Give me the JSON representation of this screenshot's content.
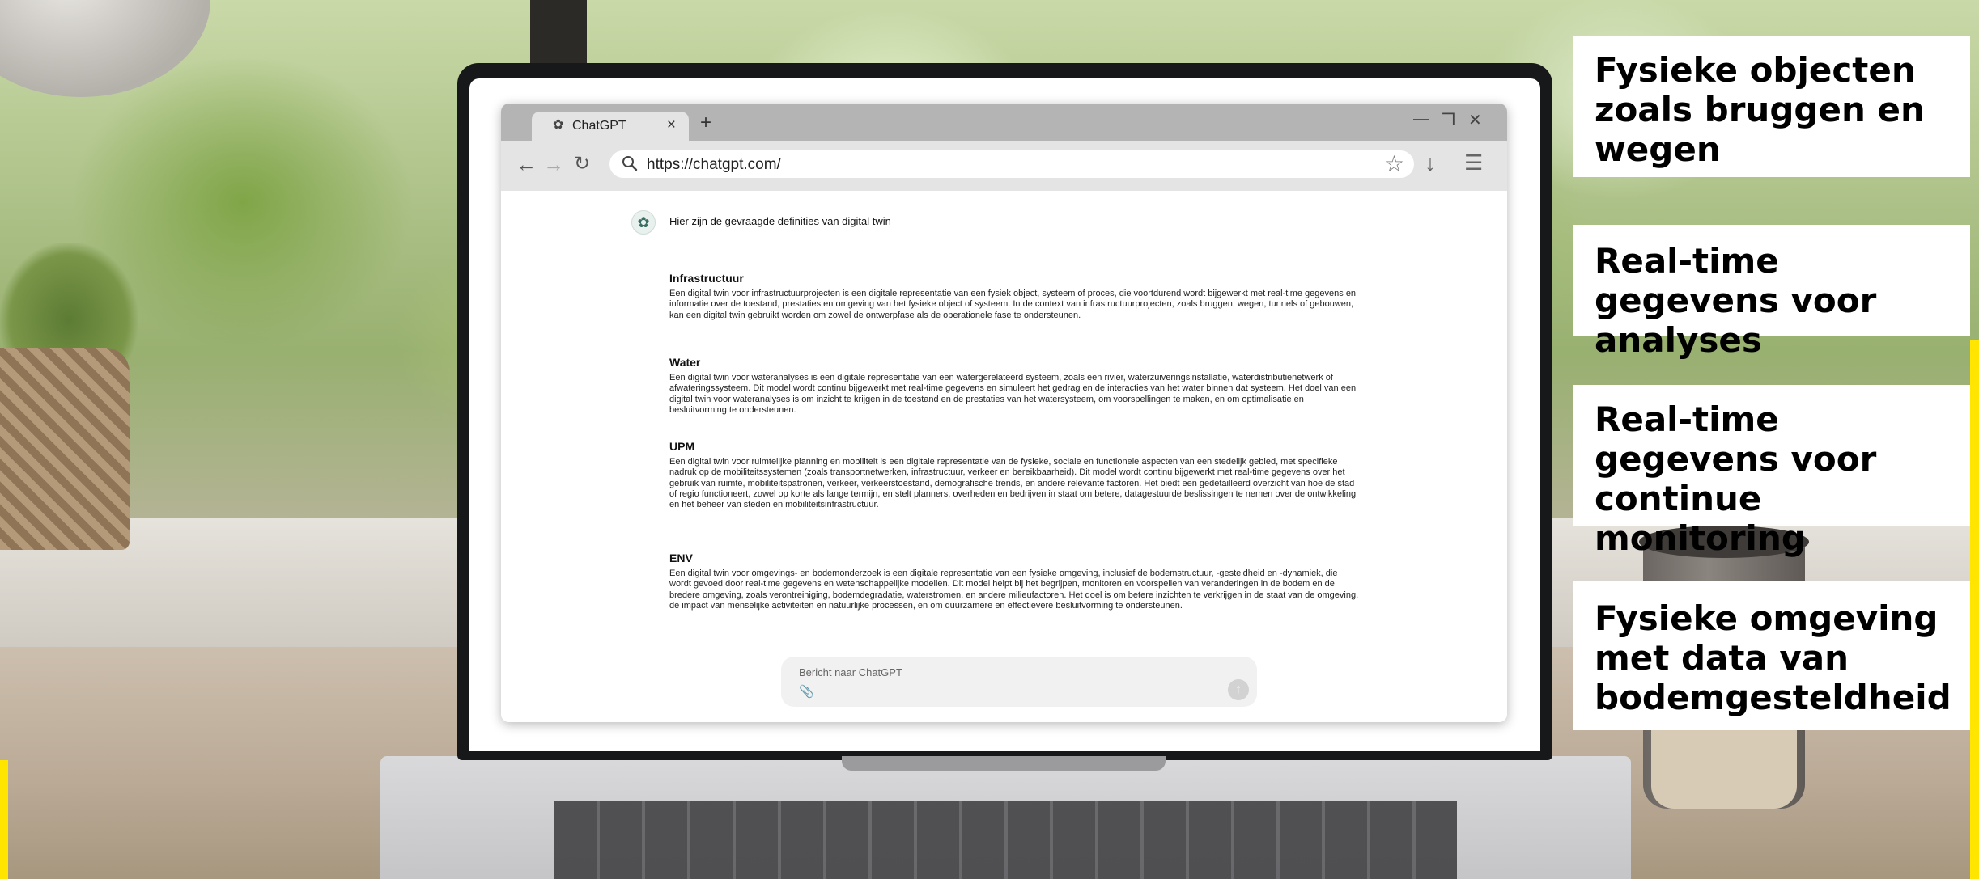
{
  "browser": {
    "tab_title": "ChatGPT",
    "tab_close": "×",
    "new_tab": "+",
    "win_min": "—",
    "win_restore": "❐",
    "win_close": "✕",
    "back": "←",
    "forward": "→",
    "reload": "↻",
    "url": "https://chatgpt.com/",
    "bookmark": "☆",
    "download": "↓",
    "menu": "☰"
  },
  "chat": {
    "intro": "Hier zijn de gevraagde definities van digital twin",
    "sections": [
      {
        "heading": "Infrastructuur",
        "text": "Een digital twin voor infrastructuurprojecten is een digitale representatie van een fysiek object, systeem of proces, die voortdurend wordt bijgewerkt met real-time gegevens en informatie over de toestand, prestaties en omgeving van het fysieke object of systeem. In de context van infrastructuurprojecten, zoals bruggen, wegen, tunnels of gebouwen, kan een digital twin gebruikt worden om zowel de ontwerpfase als de operationele fase te ondersteunen."
      },
      {
        "heading": "Water",
        "text": "Een digital twin voor wateranalyses is een digitale representatie van een watergerelateerd systeem, zoals een rivier, waterzuiveringsinstallatie, waterdistributienetwerk of afwateringssysteem. Dit model wordt continu bijgewerkt met real-time gegevens en simuleert het gedrag en de interacties van het water binnen dat systeem. Het doel van een digital twin voor wateranalyses is om inzicht te krijgen in de toestand en de prestaties van het watersysteem, om voorspellingen te maken, en om optimalisatie en besluitvorming te ondersteunen."
      },
      {
        "heading": "UPM",
        "text": "Een digital twin voor ruimtelijke planning en mobiliteit is een digitale representatie van de fysieke, sociale en functionele aspecten van een stedelijk gebied, met specifieke nadruk op de mobiliteitssystemen (zoals transportnetwerken, infrastructuur, verkeer en bereikbaarheid). Dit model wordt continu bijgewerkt met real-time gegevens over het gebruik van ruimte, mobiliteitspatronen, verkeer, verkeerstoestand, demografische trends, en andere relevante factoren. Het biedt een gedetailleerd overzicht van hoe de stad of regio functioneert, zowel op korte als lange termijn, en stelt planners, overheden en bedrijven in staat om betere, datagestuurde beslissingen te nemen over de ontwikkeling en het beheer van steden en mobiliteitsinfrastructuur."
      },
      {
        "heading": "ENV",
        "text": "Een digital twin voor omgevings- en bodemonderzoek is een digitale representatie van een fysieke omgeving, inclusief de bodemstructuur, -gesteldheid en -dynamiek, die wordt gevoed door real-time gegevens en wetenschappelijke modellen. Dit model helpt bij het begrijpen, monitoren en voorspellen van veranderingen in de bodem en de bredere omgeving, zoals verontreiniging, bodemdegradatie, waterstromen, en andere milieufactoren. Het doel is om betere inzichten te verkrijgen in de staat van de omgeving, de impact van menselijke activiteiten en natuurlijke processen, en om duurzamere en effectievere besluitvorming te ondersteunen."
      }
    ],
    "composer_placeholder": "Bericht naar ChatGPT",
    "attach_icon": "paperclip-icon",
    "send_icon": "arrow-up-icon"
  },
  "cards": [
    "Fysieke objecten zoals bruggen en wegen",
    "Real-time gegevens voor analyses",
    "Real-time gegevens voor continue monitoring",
    "Fysieke omgeving met data van bodemgesteldheid"
  ],
  "colors": {
    "accent_yellow": "#ffe500",
    "laptop_bezel": "#17181a",
    "tab_bar": "#b4b4b4"
  }
}
